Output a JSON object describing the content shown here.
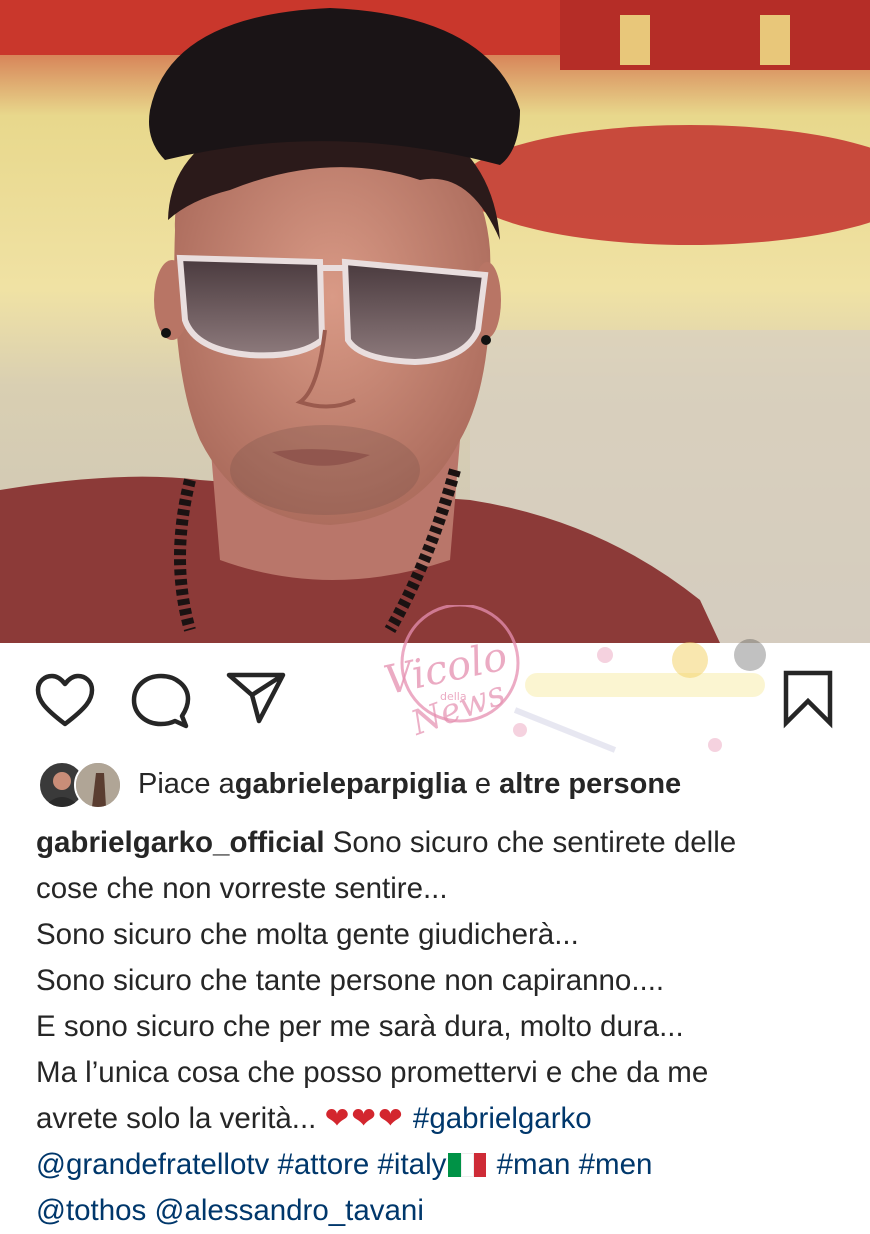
{
  "post": {
    "image_alt": "Selfie of a man wearing a black cap and tinted sunglasses with a beaded necklace",
    "liked_by_prefix": "Piace a ",
    "liked_by_user": "gabrieleparpiglia",
    "liked_by_middle": " e ",
    "liked_by_suffix": "altre persone",
    "username": "gabrielgarko_official",
    "caption_lines": [
      " Sono sicuro che sentirete delle",
      "cose che non vorreste sentire...",
      "Sono sicuro che molta gente giudicherà...",
      "Sono sicuro che tante persone non capiranno....",
      "E sono sicuro che per me sarà dura, molto dura...",
      "Ma l’unica cosa che posso promettervi e che da me",
      "avrete solo la verità... "
    ],
    "hearts": "❤❤❤",
    "tags_line1": " #gabrielgarko",
    "tags_line2_a": "@grandefratellotv #attore #italy",
    "tags_line2_b": " #man #men",
    "tags_line3": "@tothos @alessandro_tavani"
  },
  "actions": {
    "like_icon": "heart-outline-icon",
    "comment_icon": "comment-bubble-icon",
    "share_icon": "paper-plane-icon",
    "save_icon": "bookmark-icon"
  },
  "watermark": {
    "text_main": "Vicolo",
    "text_small": "della",
    "text_news": "News"
  },
  "colors": {
    "link": "#00376b",
    "heart": "#d3262e",
    "text": "#262626",
    "watermark_pink": "#e58fb0"
  }
}
